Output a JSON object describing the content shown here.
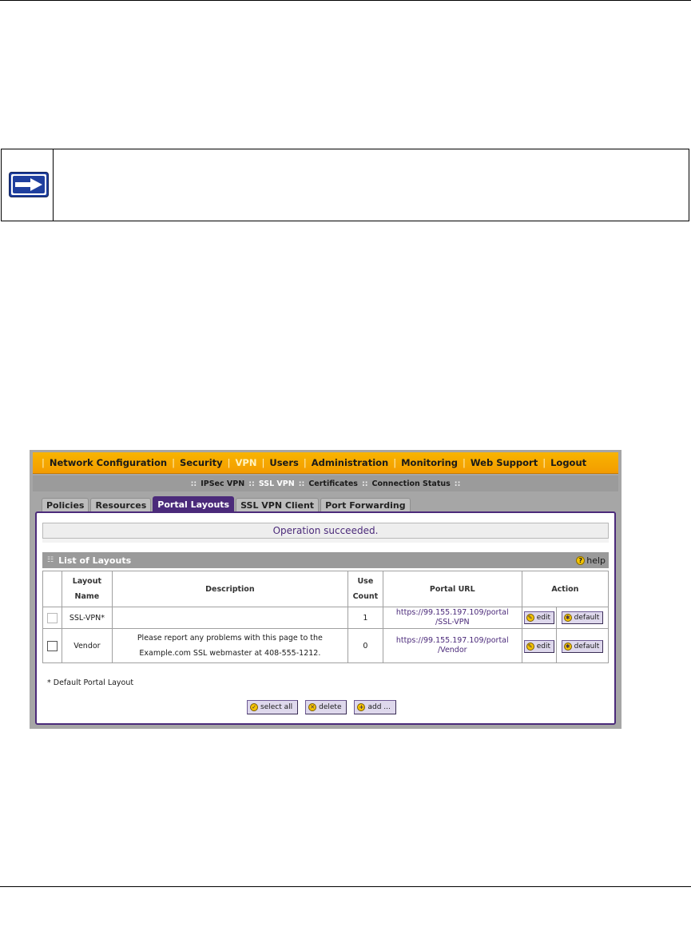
{
  "menubar": {
    "items": [
      "Network Configuration",
      "Security",
      "VPN",
      "Users",
      "Administration",
      "Monitoring",
      "Web Support",
      "Logout"
    ],
    "active": "VPN"
  },
  "submenu": {
    "items": [
      "IPSec VPN",
      "SSL VPN",
      "Certificates",
      "Connection Status"
    ],
    "active": "SSL VPN"
  },
  "tabs": {
    "items": [
      "Policies",
      "Resources",
      "Portal Layouts",
      "SSL VPN Client",
      "Port Forwarding"
    ],
    "active": "Portal Layouts"
  },
  "status_message": "Operation succeeded.",
  "list": {
    "title": "List of Layouts",
    "help_label": "help",
    "columns": {
      "name_line1": "Layout",
      "name_line2": "Name",
      "description": "Description",
      "use_line1": "Use",
      "use_line2": "Count",
      "url": "Portal URL",
      "action": "Action"
    },
    "rows": [
      {
        "name": "SSL-VPN*",
        "description_line1": "",
        "description_line2": "",
        "use_count": "1",
        "url_line1": "https://99.155.197.109/portal",
        "url_line2": "/SSL-VPN",
        "edit_label": "edit",
        "default_label": "default"
      },
      {
        "name": "Vendor",
        "description_line1": "Please report any problems with this page to the",
        "description_line2": "Example.com SSL webmaster at 408-555-1212.",
        "use_count": "0",
        "url_line1": "https://99.155.197.109/portal",
        "url_line2": "/Vendor",
        "edit_label": "edit",
        "default_label": "default"
      }
    ]
  },
  "footnote": "* Default Portal Layout",
  "buttons": {
    "select_all": "select all",
    "delete": "delete",
    "add": "add ..."
  },
  "colors": {
    "menubar": "#f39c00",
    "accent_purple": "#4b2a7a",
    "note_arrow": "#1f3f9e"
  },
  "icons": {
    "note": "arrow-right-icon",
    "help": "help-icon",
    "edit": "edit-icon",
    "default": "default-icon",
    "select_all": "check-icon",
    "delete": "delete-icon",
    "add": "add-icon"
  }
}
